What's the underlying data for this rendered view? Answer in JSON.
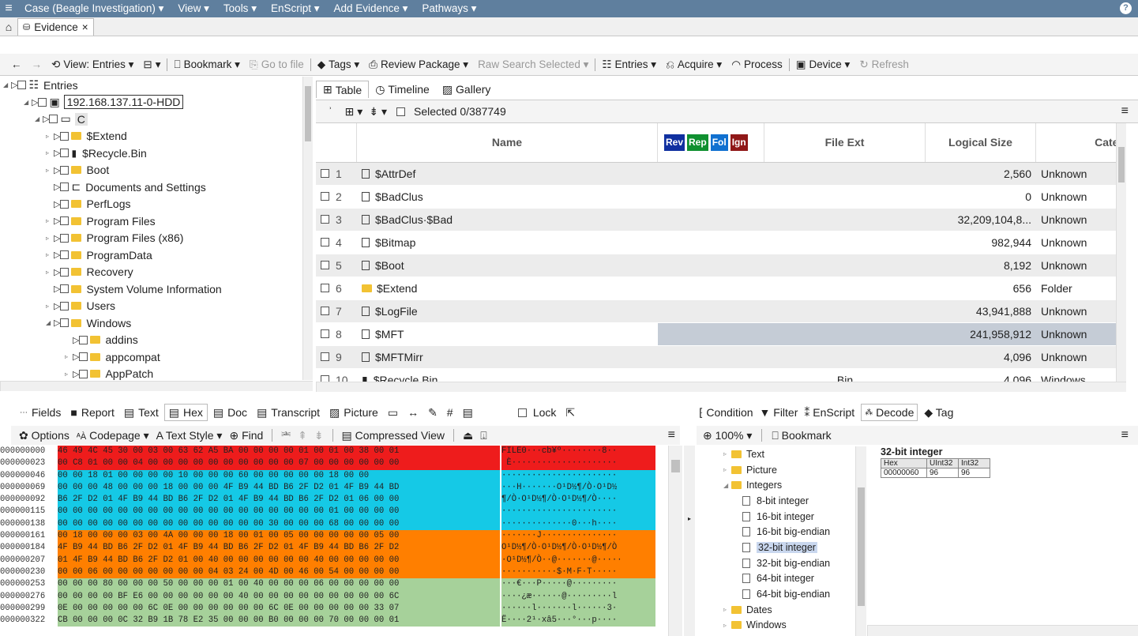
{
  "menubar": {
    "items": [
      "Case (Beagle Investigation) ▾",
      "View ▾",
      "Tools ▾",
      "EnScript ▾",
      "Add Evidence ▾",
      "Pathways ▾"
    ],
    "help": "?"
  },
  "tab": {
    "label": "Evidence",
    "close": "×"
  },
  "toolbar": {
    "view": "View: Entries ▾",
    "bookmark": "Bookmark ▾",
    "goto": "Go to file",
    "tags": "Tags ▾",
    "review": "Review Package ▾",
    "raw": "Raw Search Selected ▾",
    "entries": "Entries ▾",
    "acquire": "Acquire ▾",
    "process": "Process",
    "device": "Device ▾",
    "refresh": "Refresh"
  },
  "tree": {
    "root": "Entries",
    "device": "192.168.137.11-0-HDD",
    "volume": "C",
    "items": [
      {
        "label": "$Extend",
        "icon": "folder"
      },
      {
        "label": "$Recycle.Bin",
        "icon": "recycle"
      },
      {
        "label": "Boot",
        "icon": "folder"
      },
      {
        "label": "Documents and Settings",
        "icon": "link-folder"
      },
      {
        "label": "PerfLogs",
        "icon": "folder"
      },
      {
        "label": "Program Files",
        "icon": "folder"
      },
      {
        "label": "Program Files (x86)",
        "icon": "folder"
      },
      {
        "label": "ProgramData",
        "icon": "folder"
      },
      {
        "label": "Recovery",
        "icon": "folder"
      },
      {
        "label": "System Volume Information",
        "icon": "folder"
      },
      {
        "label": "Users",
        "icon": "folder"
      },
      {
        "label": "Windows",
        "icon": "folder"
      }
    ],
    "sub": [
      {
        "label": "addins"
      },
      {
        "label": "appcompat"
      },
      {
        "label": "AppPatch"
      }
    ]
  },
  "viewtabs": {
    "table": "Table",
    "timeline": "Timeline",
    "gallery": "Gallery"
  },
  "tablebar": {
    "selected": "Selected 0/387749"
  },
  "grid": {
    "headers": {
      "name": "Name",
      "file_ext": "File Ext",
      "logical_size": "Logical Size",
      "category": "Categ"
    },
    "badges": [
      {
        "text": "Rev",
        "color": "#1030a0"
      },
      {
        "text": "Rep",
        "color": "#109030"
      },
      {
        "text": "Fol",
        "color": "#1070d0"
      },
      {
        "text": "Ign",
        "color": "#901818"
      }
    ],
    "rows": [
      {
        "n": "1",
        "name": "$AttrDef",
        "ext": "",
        "size": "2,560",
        "cat": "Unknown",
        "icon": "file"
      },
      {
        "n": "2",
        "name": "$BadClus",
        "ext": "",
        "size": "0",
        "cat": "Unknown",
        "icon": "file"
      },
      {
        "n": "3",
        "name": "$BadClus·$Bad",
        "ext": "",
        "size": "32,209,104,8...",
        "cat": "Unknown",
        "icon": "file"
      },
      {
        "n": "4",
        "name": "$Bitmap",
        "ext": "",
        "size": "982,944",
        "cat": "Unknown",
        "icon": "file"
      },
      {
        "n": "5",
        "name": "$Boot",
        "ext": "",
        "size": "8,192",
        "cat": "Unknown",
        "icon": "file"
      },
      {
        "n": "6",
        "name": "$Extend",
        "ext": "",
        "size": "656",
        "cat": "Folder",
        "icon": "folder"
      },
      {
        "n": "7",
        "name": "$LogFile",
        "ext": "",
        "size": "43,941,888",
        "cat": "Unknown",
        "icon": "file"
      },
      {
        "n": "8",
        "name": "$MFT",
        "ext": "",
        "size": "241,958,912",
        "cat": "Unknown",
        "icon": "file"
      },
      {
        "n": "9",
        "name": "$MFTMirr",
        "ext": "",
        "size": "4,096",
        "cat": "Unknown",
        "icon": "file"
      },
      {
        "n": "10",
        "name": "$Recycle.Bin",
        "ext": "Bin",
        "size": "4,096",
        "cat": "Windows",
        "icon": "recycle"
      }
    ]
  },
  "bottomtabs": {
    "fields": "Fields",
    "report": "Report",
    "text": "Text",
    "hex": "Hex",
    "doc": "Doc",
    "transcript": "Transcript",
    "picture": "Picture",
    "lock": "Lock"
  },
  "hexbar": {
    "options": "Options",
    "codepage": "Codepage ▾",
    "textstyle": "Text Style ▾",
    "find": "Find",
    "compressed": "Compressed View"
  },
  "hex": {
    "rows": [
      {
        "o": "000000000",
        "b": "46 49 4C 45 30 00 03 00 63 62 A5 BA 00 00 00 00 01 00 01 00 38 00 01 ",
        "a": "FILE0···cb¥º········8··",
        "c": "#ee1c1c"
      },
      {
        "o": "000000023",
        "b": "00 C8 01 00 00 04 00 00 00 00 00 00 00 00 00 00 07 00 00 00 00 00 00 ",
        "a": " È·····················",
        "c": "#ee1c1c"
      },
      {
        "o": "000000046",
        "b": "00 00 18 01 00 00 00 00 10 00 00 00 60 00 00 00 00 00 18 00 00 ",
        "a": "·······················",
        "c": "#15c9e6"
      },
      {
        "o": "000000069",
        "b": "00 00 00 48 00 00 00 18 00 00 00 4F B9 44 BD B6 2F D2 01 4F B9 44 BD ",
        "a": "···H·······O¹D½¶/Ò·O¹D½",
        "c": "#15c9e6"
      },
      {
        "o": "000000092",
        "b": "B6 2F D2 01 4F B9 44 BD B6 2F D2 01 4F B9 44 BD B6 2F D2 01 06 00 00 ",
        "a": "¶/Ò·O¹D½¶/Ò·O¹D½¶/Ò····",
        "c": "#15c9e6"
      },
      {
        "o": "000000115",
        "b": "00 00 00 00 00 00 00 00 00 00 00 00 00 00 00 00 00 00 01 00 00 00 00 ",
        "a": "·······················",
        "c": "#15c9e6"
      },
      {
        "o": "000000138",
        "b": "00 00 00 00 00 00 00 00 00 00 00 00 00 00 30 00 00 00 68 00 00 00 00 ",
        "a": "··············0···h····",
        "c": "#15c9e6"
      },
      {
        "o": "000000161",
        "b": "00 18 00 00 00 03 00 4A 00 00 00 18 00 01 00 05 00 00 00 00 00 05 00 ",
        "a": "·······J···············",
        "c": "#ff7f00"
      },
      {
        "o": "000000184",
        "b": "4F B9 44 BD B6 2F D2 01 4F B9 44 BD B6 2F D2 01 4F B9 44 BD B6 2F D2 ",
        "a": "O¹D½¶/Ò·O¹D½¶/Ò·O¹D½¶/Ò",
        "c": "#ff7f00"
      },
      {
        "o": "000000207",
        "b": "01 4F B9 44 BD B6 2F D2 01 00 40 00 00 00 00 00 00 40 00 00 00 00 00 ",
        "a": "·O¹D½¶/Ò··@·······@·····",
        "c": "#ff7f00"
      },
      {
        "o": "000000230",
        "b": "00 00 06 00 00 00 00 00 00 00 04 03 24 00 4D 00 46 00 54 00 00 00 00 ",
        "a": "···········$·M·F·T·····",
        "c": "#ff7f00"
      },
      {
        "o": "000000253",
        "b": "00 00 00 80 00 00 00 50 00 00 00 01 00 40 00 00 00 06 00 00 00 00 00 ",
        "a": "···€···P·····@·········",
        "c": "#a6d19a"
      },
      {
        "o": "000000276",
        "b": "00 00 00 00 BF E6 00 00 00 00 00 00 40 00 00 00 00 00 00 00 00 00 6C ",
        "a": "····¿æ······@·········l",
        "c": "#a6d19a"
      },
      {
        "o": "000000299",
        "b": "0E 00 00 00 00 00 6C 0E 00 00 00 00 00 00 6C 0E 00 00 00 00 00 33 07 ",
        "a": "······l·······l······3·",
        "c": "#a6d19a"
      },
      {
        "o": "000000322",
        "b": "CB 00 00 00 0C 32 B9 1B 78 E2 35 00 00 00 B0 00 00 00 70 00 00 00 01 ",
        "a": "Ë····2¹·xâ5···°···p····",
        "c": "#a6d19a"
      }
    ]
  },
  "righttabs": {
    "condition": "Condition",
    "filter": "Filter",
    "enscript": "EnScript",
    "decode": "Decode",
    "tag": "Tag"
  },
  "rbar": {
    "zoom": "100% ▾",
    "bookmark": "Bookmark"
  },
  "decode": {
    "items": [
      {
        "t": "Text",
        "k": "folder",
        "i": 0
      },
      {
        "t": "Picture",
        "k": "folder",
        "i": 0
      },
      {
        "t": "Integers",
        "k": "folder",
        "i": 0
      },
      {
        "t": "8-bit integer",
        "k": "file",
        "i": 1
      },
      {
        "t": "16-bit integer",
        "k": "file",
        "i": 1
      },
      {
        "t": "16-bit big-endian",
        "k": "file",
        "i": 1
      },
      {
        "t": "32-bit integer",
        "k": "file",
        "i": 1
      },
      {
        "t": "32-bit big-endian",
        "k": "file",
        "i": 1
      },
      {
        "t": "64-bit integer",
        "k": "file",
        "i": 1
      },
      {
        "t": "64-bit big-endian",
        "k": "file",
        "i": 1
      },
      {
        "t": "Dates",
        "k": "folder",
        "i": 0
      },
      {
        "t": "Windows",
        "k": "folder",
        "i": 0
      }
    ]
  },
  "result": {
    "title": "32-bit integer",
    "h1": "Hex",
    "h2": "UInt32",
    "h3": "Int32",
    "v1": "00000060",
    "v2": "96",
    "v3": "96"
  }
}
